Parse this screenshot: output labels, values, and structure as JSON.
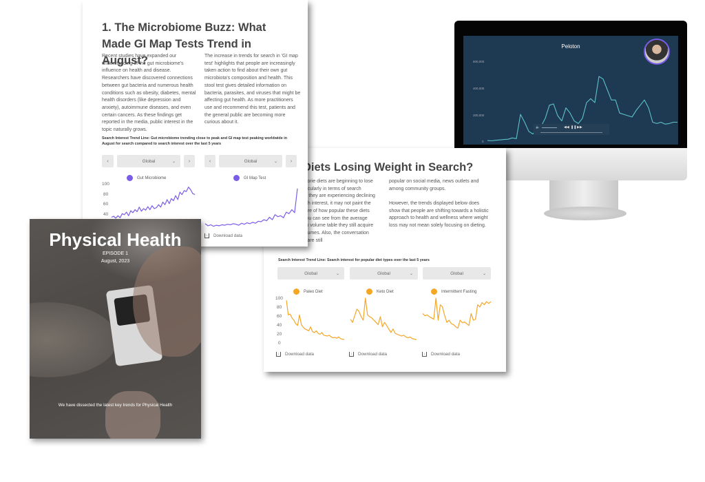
{
  "doc1": {
    "title": "1. The Microbiome Buzz: What Made GI Map Tests Trend in August?",
    "para_left": "Recent studies have expanded our understanding of the gut microbiome's influence on health and disease. Researchers have discovered connections between gut bacteria and numerous health conditions such as obesity, diabetes, mental health disorders (like depression and anxiety), autoimmune diseases, and even certain cancers. As these findings get reported in the media, public interest in the topic naturally grows.",
    "para_right": "The increase in trends for search in 'GI map test' highlights that people are increasingly taken action to find about their own gut microbiota's composition and health. This stool test gives detailed information on bacteria, parasites, and viruses that might be affecting gut health. As more practitioners use and recommend this test, patients and the general public are becoming more curious about it.",
    "caption": "Search Interest Trend Line: Gut microbiome trending close to peak and GI map test peaking worldwide in August for search compared to search interest over the last 5 years",
    "prev": "‹",
    "next": "›",
    "select_value": "Global",
    "chevron": "⌄",
    "download": "Download data",
    "download_icon": "↓"
  },
  "doc2": {
    "title": "Diets Losing Weight in Search?",
    "para_left_lines": [
      "alorie diets are beginning to lose",
      "rticularly in terms of search",
      "st they are experiencing declining",
      "rch interest, it may not paint the",
      "ture of how popular these diets",
      "you can see from the average",
      "ch volume table they still acquire",
      "olumes. Also, the conversation",
      "s are still"
    ],
    "para_right_1": "popular on social media, news outlets and among community groups.",
    "para_right_2": "However, the trends displayed below does show that people are shifting towards a holistic approach to health and wellness where weight loss may not mean solely focusing on dieting.",
    "caption": "Search Interest Trend Line: Search interest for popular diet types over the last 5 years",
    "select_value": "Global",
    "chevron": "⌄",
    "download": "Download data",
    "download_icon": "↓"
  },
  "cover": {
    "title": "Physical Health",
    "episode": "EPISODE 1",
    "date": "August, 2023",
    "tagline": "We have dissected the latest key trends for Physical Health"
  },
  "monitor": {
    "video_title": "Peloton",
    "controls": {
      "rewind": "◀◀",
      "pause": "❚❚",
      "forward": "▶▶",
      "volume": "🔈"
    }
  },
  "colors": {
    "purple": "#7b5ce8",
    "orange": "#f5a623",
    "teal": "#5fc2c8",
    "screen": "#1e3a52"
  },
  "chart_data": [
    {
      "id": "gut",
      "type": "line",
      "name": "Gut Microbiome",
      "color": "#7b5ce8",
      "ylim": [
        0,
        100
      ],
      "yticks": [
        "100",
        "80",
        "60",
        "40"
      ],
      "values": [
        35,
        37,
        33,
        38,
        34,
        42,
        40,
        45,
        38,
        48,
        44,
        50,
        46,
        55,
        47,
        52,
        49,
        56,
        50,
        58,
        52,
        54,
        60,
        55,
        65,
        60,
        70,
        62,
        72,
        68,
        78,
        70,
        85,
        80,
        88,
        86,
        95,
        90,
        82,
        80
      ]
    },
    {
      "id": "gi",
      "type": "line",
      "name": "GI Map Test",
      "color": "#7b5ce8",
      "ylim": [
        0,
        100
      ],
      "yticks": [],
      "values": [
        22,
        18,
        20,
        17,
        19,
        18,
        20,
        19,
        21,
        20,
        22,
        21,
        19,
        23,
        21,
        24,
        22,
        25,
        23,
        27,
        26,
        30,
        28,
        35,
        30,
        40,
        36,
        38,
        34,
        45,
        42,
        50,
        44,
        92
      ]
    },
    {
      "id": "paleo",
      "type": "line",
      "name": "Paleo Diet",
      "color": "#f5a623",
      "ylim": [
        0,
        100
      ],
      "yticks": [
        "100",
        "80",
        "60",
        "40",
        "20",
        "0"
      ],
      "values": [
        95,
        62,
        64,
        55,
        50,
        42,
        38,
        62,
        40,
        34,
        30,
        28,
        26,
        35,
        24,
        22,
        26,
        20,
        18,
        22,
        16,
        15,
        14,
        16,
        12,
        10,
        11,
        9,
        12,
        8,
        7,
        6
      ]
    },
    {
      "id": "keto",
      "type": "line",
      "name": "Keto Diet",
      "color": "#f5a623",
      "ylim": [
        0,
        100
      ],
      "yticks": [],
      "values": [
        52,
        45,
        60,
        75,
        70,
        58,
        50,
        100,
        62,
        58,
        55,
        50,
        45,
        40,
        58,
        35,
        45,
        38,
        30,
        22,
        30,
        20,
        18,
        16,
        14,
        16,
        12,
        10,
        12,
        8,
        7,
        6
      ]
    },
    {
      "id": "if",
      "type": "line",
      "name": "Intermittent Fasting",
      "color": "#f5a623",
      "ylim": [
        0,
        100
      ],
      "yticks": [],
      "values": [
        65,
        60,
        62,
        58,
        55,
        52,
        100,
        50,
        85,
        80,
        60,
        45,
        50,
        42,
        40,
        35,
        32,
        50,
        44,
        46,
        42,
        38,
        65,
        50,
        52,
        85,
        80,
        90,
        85,
        92,
        88,
        92
      ]
    },
    {
      "id": "peloton",
      "type": "line",
      "title": "Peloton",
      "color": "#5fc2c8",
      "ylim": [
        0,
        600000
      ],
      "yticks": [
        "600,000",
        "400,000",
        "200,000",
        "0"
      ],
      "values": [
        10000,
        8000,
        12000,
        15000,
        18000,
        20000,
        30000,
        25000,
        210000,
        150000,
        80000,
        60000,
        100000,
        120000,
        180000,
        280000,
        290000,
        200000,
        160000,
        260000,
        220000,
        160000,
        140000,
        180000,
        300000,
        330000,
        300000,
        500000,
        480000,
        400000,
        320000,
        320000,
        220000,
        210000,
        200000,
        190000,
        240000,
        280000,
        320000,
        260000,
        150000,
        140000,
        150000,
        135000,
        140000,
        150000,
        150000
      ]
    }
  ]
}
